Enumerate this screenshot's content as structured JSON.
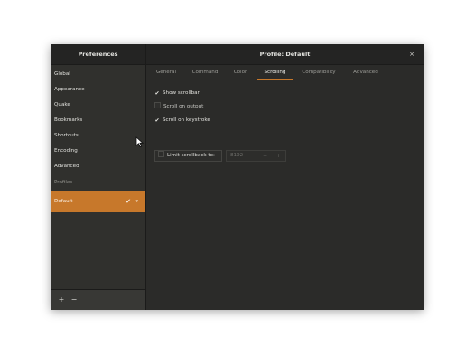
{
  "window": {
    "sidebar_title": "Preferences",
    "profile_title": "Profile: Default",
    "close_glyph": "×"
  },
  "sidebar": {
    "items": [
      {
        "label": "Global"
      },
      {
        "label": "Appearance"
      },
      {
        "label": "Quake"
      },
      {
        "label": "Bookmarks"
      },
      {
        "label": "Shortcuts"
      },
      {
        "label": "Encoding"
      },
      {
        "label": "Advanced"
      }
    ],
    "profiles_header": "Profiles",
    "selected_profile": "Default",
    "selected_check": "✔",
    "selected_caret": "▾",
    "add_glyph": "+",
    "remove_glyph": "−"
  },
  "tabs": [
    {
      "label": "General"
    },
    {
      "label": "Command"
    },
    {
      "label": "Color"
    },
    {
      "label": "Scrolling"
    },
    {
      "label": "Compatibility"
    },
    {
      "label": "Advanced"
    }
  ],
  "active_tab": "Scrolling",
  "scrolling": {
    "show_scrollbar": {
      "label": "Show scrollbar",
      "checked": true
    },
    "scroll_on_output": {
      "label": "Scroll on output",
      "checked": false
    },
    "scroll_on_keystroke": {
      "label": "Scroll on keystroke",
      "checked": true
    },
    "limit_scrollback": {
      "label": "Limit scrollback to:",
      "checked": false
    },
    "scrollback_value": "8192",
    "check_glyph": "✔"
  },
  "colors": {
    "accent": "#c7782b",
    "window_bg": "#2b2b29",
    "sidebar_bg": "#30302d"
  }
}
